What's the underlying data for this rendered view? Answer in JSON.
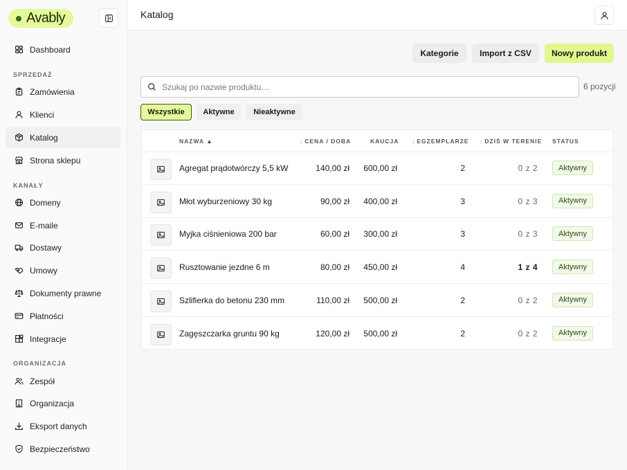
{
  "app": {
    "logo": "Avably"
  },
  "header": {
    "title": "Katalog"
  },
  "sidebar": {
    "items_top": [
      {
        "label": "Dashboard",
        "icon": "dashboard-icon"
      }
    ],
    "sections": [
      {
        "label": "SPRZEDAŻ",
        "items": [
          {
            "label": "Zamówienia",
            "icon": "clipboard-icon"
          },
          {
            "label": "Klienci",
            "icon": "user-icon"
          },
          {
            "label": "Katalog",
            "icon": "package-icon",
            "active": true
          },
          {
            "label": "Strona sklepu",
            "icon": "store-icon"
          }
        ]
      },
      {
        "label": "KANAŁY",
        "items": [
          {
            "label": "Domeny",
            "icon": "globe-icon"
          },
          {
            "label": "E-maile",
            "icon": "mail-icon"
          },
          {
            "label": "Dostawy",
            "icon": "truck-icon"
          },
          {
            "label": "Umowy",
            "icon": "handshake-icon"
          },
          {
            "label": "Dokumenty prawne",
            "icon": "scale-icon"
          },
          {
            "label": "Płatności",
            "icon": "card-icon"
          },
          {
            "label": "Integracje",
            "icon": "puzzle-icon"
          }
        ]
      },
      {
        "label": "ORGANIZACJA",
        "items": [
          {
            "label": "Zespół",
            "icon": "users-icon"
          },
          {
            "label": "Organizacja",
            "icon": "building-icon"
          },
          {
            "label": "Eksport danych",
            "icon": "download-icon"
          },
          {
            "label": "Bezpieczeństwo",
            "icon": "shield-icon"
          }
        ]
      }
    ]
  },
  "toolbar": {
    "categories": "Kategorie",
    "import": "Import z CSV",
    "new_product": "Nowy produkt"
  },
  "search": {
    "placeholder": "Szukaj po nazwie produktu…",
    "value": "",
    "count": "6 pozycji"
  },
  "filters": {
    "all": "Wszystkie",
    "active": "Aktywne",
    "inactive": "Nieaktywne",
    "selected": "Wszystkie"
  },
  "table": {
    "columns": {
      "name": "NAZWA",
      "price": "CENA / DOBA",
      "deposit": "KAUCJA",
      "units": "EGZEMPLARZE",
      "today": "DZIŚ W TERENIE",
      "status": "STATUS"
    },
    "rows": [
      {
        "name": "Agregat prądotwórczy 5,5 kW",
        "price": "140,00 zł",
        "deposit": "600,00 zł",
        "units": "2",
        "today": "0 z 2",
        "status": "Aktywny"
      },
      {
        "name": "Młot wyburzeniowy 30 kg",
        "price": "90,00 zł",
        "deposit": "400,00 zł",
        "units": "3",
        "today": "0 z 3",
        "status": "Aktywny"
      },
      {
        "name": "Myjka ciśnieniowa 200 bar",
        "price": "60,00 zł",
        "deposit": "300,00 zł",
        "units": "3",
        "today": "0 z 3",
        "status": "Aktywny"
      },
      {
        "name": "Rusztowanie jezdne 6 m",
        "price": "80,00 zł",
        "deposit": "450,00 zł",
        "units": "4",
        "today": "1 z 4",
        "status": "Aktywny"
      },
      {
        "name": "Szlifierka do betonu 230 mm",
        "price": "110,00 zł",
        "deposit": "500,00 zł",
        "units": "2",
        "today": "0 z 2",
        "status": "Aktywny"
      },
      {
        "name": "Zagęszczarka gruntu 90 kg",
        "price": "120,00 zł",
        "deposit": "500,00 zł",
        "units": "2",
        "today": "0 z 2",
        "status": "Aktywny"
      }
    ]
  },
  "colors": {
    "accent": "#e0f88e",
    "accent_border": "#3d5a12",
    "badge_bg": "#f1f9e8",
    "badge_text": "#2d4a15"
  }
}
